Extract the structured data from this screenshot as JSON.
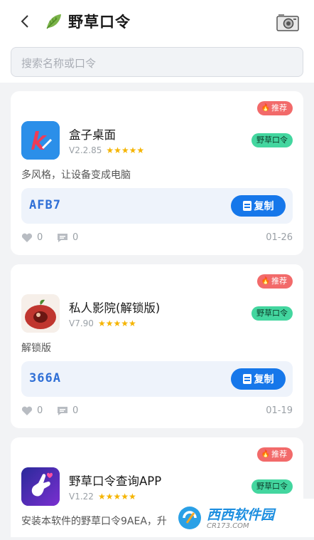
{
  "header": {
    "title": "野草口令",
    "back_icon": "chevron-left-icon",
    "leaf_icon": "leaf-icon",
    "camera_icon": "camera-icon"
  },
  "search": {
    "placeholder": "搜索名称或口令"
  },
  "colors": {
    "primary": "#1677ea",
    "recommend_badge": "#f26a6a",
    "green_tag": "#43d69f",
    "star": "#f5b400"
  },
  "cards": [
    {
      "recommend": "推荐",
      "tag": "野草口令",
      "name": "盒子桌面",
      "version": "V2.2.85",
      "stars": "★★★★★",
      "description": "多风格，让设备变成电脑",
      "code": "AFB7",
      "copy_label": "复制",
      "likes": "0",
      "comments": "0",
      "date": "01-26"
    },
    {
      "recommend": "推荐",
      "tag": "野草口令",
      "name": "私人影院(解锁版)",
      "version": "V7.90",
      "stars": "★★★★★",
      "description": "解锁版",
      "code": "366A",
      "copy_label": "复制",
      "likes": "0",
      "comments": "0",
      "date": "01-19"
    },
    {
      "recommend": "推荐",
      "tag": "野草口令",
      "name": "野草口令查询APP",
      "version": "V1.22",
      "stars": "★★★★★",
      "description": "安装本软件的野草口令9AEA，升"
    }
  ],
  "watermark": {
    "text": "西西软件园",
    "sub": "CR173.COM"
  }
}
